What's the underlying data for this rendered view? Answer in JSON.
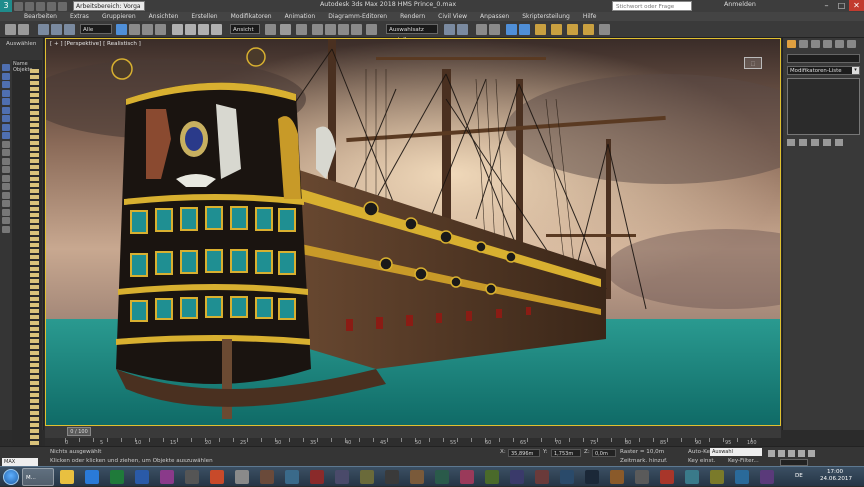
{
  "titlebar": {
    "workspace": "Arbeitsbereich: Vorga",
    "title": "Autodesk 3ds Max 2018     HMS Prince_0.max",
    "search_placeholder": "Stichwort oder Frage eingeben",
    "login": "Anmelden",
    "minimize": "–",
    "maximize": "□",
    "close": "✕"
  },
  "menu": [
    "Bearbeiten",
    "Extras",
    "Gruppieren",
    "Ansichten",
    "Erstellen",
    "Modifikatoren",
    "Animation",
    "Diagramm-Editoren",
    "Rendern",
    "Civil View",
    "Anpassen",
    "Skriptersteilung",
    "Hilfe"
  ],
  "toolbar": {
    "filter": "Alle",
    "view": "Ansicht",
    "selection_set": "Auswahlsatz erstellen"
  },
  "left_panel": {
    "title": "Auswählen",
    "list_header": "Name Objekte"
  },
  "viewport": {
    "label": "[ + ] [Perspektive] [ Realistisch ]"
  },
  "command_panel": {
    "modifier_list": "Modifikatoren-Liste"
  },
  "timeline": {
    "frame": "0 / 100",
    "ticks": [
      "0",
      "5",
      "10",
      "15",
      "20",
      "25",
      "30",
      "35",
      "40",
      "45",
      "50",
      "55",
      "60",
      "65",
      "70",
      "75",
      "80",
      "85",
      "90",
      "95",
      "100"
    ]
  },
  "status": {
    "selection": "Nichts ausgewählt",
    "prompt": "Klicken oder klicken und ziehen, um Objekte auszuwählen",
    "mini_listener": "MAX",
    "x_label": "X:",
    "x_value": "35,896m",
    "y_label": "Y:",
    "y_value": "1,753m",
    "z_label": "Z:",
    "z_value": "0,0m",
    "grid": "Raster = 10,0m",
    "time_tag": "Zeitmark. hinzuf.",
    "auto_key": "Auto-Key",
    "set_key": "Key einst.",
    "key_mode": "Auswahl",
    "key_filter": "Key-Filter..."
  },
  "taskbar": {
    "active_app": "M...",
    "lang": "DE",
    "time": "17:00",
    "date": "24.06.2017"
  },
  "colors": {
    "accent_yellow": "#e0c030",
    "close_red": "#c23b2f",
    "ui_dark": "#3a3a3a"
  }
}
